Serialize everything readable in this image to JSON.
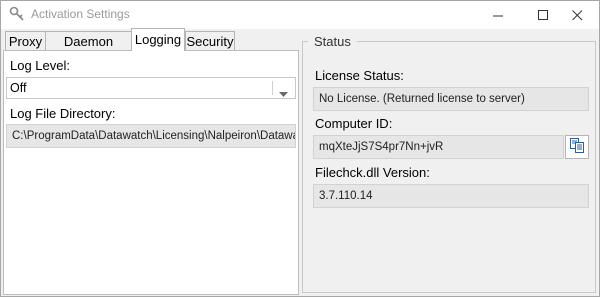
{
  "window": {
    "title": "Activation Settings",
    "icon": "key-icon",
    "controls": [
      "minimize-icon",
      "maximize-icon",
      "close-icon"
    ]
  },
  "tabs": [
    {
      "label": "Proxy",
      "active": false
    },
    {
      "label": "Daemon Proxy",
      "active": false
    },
    {
      "label": "Logging",
      "active": true
    },
    {
      "label": "Security",
      "active": false
    }
  ],
  "logging": {
    "log_level_label": "Log Level:",
    "log_level_value": "Off",
    "log_dir_label": "Log File Directory:",
    "log_dir_value": "C:\\ProgramData\\Datawatch\\Licensing\\Nalpeiron\\Datawat"
  },
  "status": {
    "group_title": "Status",
    "license_status_label": "License Status:",
    "license_status_value": "No License. (Returned license to server)",
    "computer_id_label": "Computer ID:",
    "computer_id_value": "mqXteJjS7S4pr7Nn+jvR",
    "filechck_label": "Filechck.dll Version:",
    "filechck_value": "3.7.110.14"
  },
  "colors": {
    "field_bg": "#e6e6e6",
    "window_bg": "#f0f0f0",
    "title_text": "#9a9a9a"
  }
}
